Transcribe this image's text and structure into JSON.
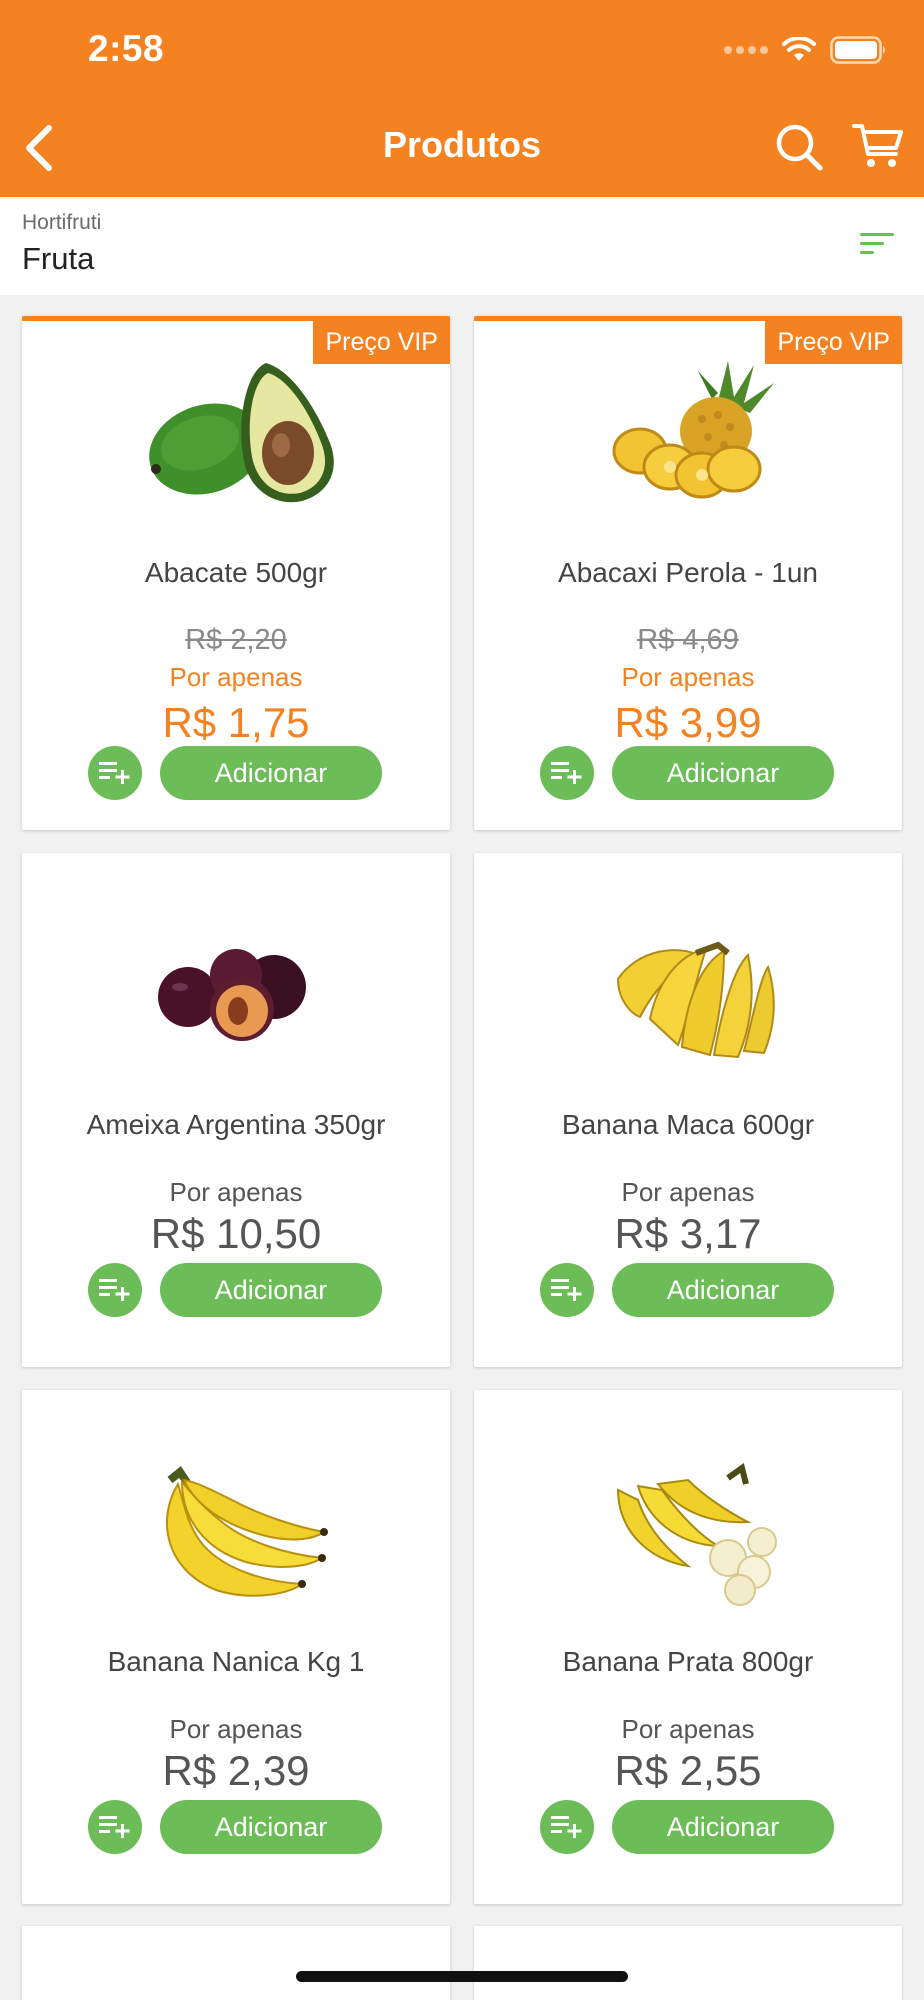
{
  "status_bar": {
    "time": "2:58"
  },
  "header": {
    "title": "Produtos"
  },
  "category": {
    "parent": "Hortifruti",
    "current": "Fruta"
  },
  "colors": {
    "brand": "#f58220",
    "action": "#6cbd58"
  },
  "products": [
    {
      "name": "Abacate 500gr",
      "badge": "Preço VIP",
      "old_price": "R$ 2,20",
      "label": "Por apenas",
      "price": "R$ 1,75",
      "button": "Adicionar",
      "image": "avocado"
    },
    {
      "name": "Abacaxi Perola - 1un",
      "badge": "Preço VIP",
      "old_price": "R$ 4,69",
      "label": "Por apenas",
      "price": "R$ 3,99",
      "button": "Adicionar",
      "image": "pineapple"
    },
    {
      "name": "Ameixa Argentina 350gr",
      "label": "Por apenas",
      "price": "R$ 10,50",
      "button": "Adicionar",
      "image": "plums"
    },
    {
      "name": "Banana Maca 600gr",
      "label": "Por apenas",
      "price": "R$ 3,17",
      "button": "Adicionar",
      "image": "banana-maca"
    },
    {
      "name": "Banana Nanica Kg 1",
      "label": "Por apenas",
      "price": "R$ 2,39",
      "button": "Adicionar",
      "image": "banana-nanica"
    },
    {
      "name": "Banana Prata 800gr",
      "label": "Por apenas",
      "price": "R$ 2,55",
      "button": "Adicionar",
      "image": "banana-prata"
    }
  ]
}
